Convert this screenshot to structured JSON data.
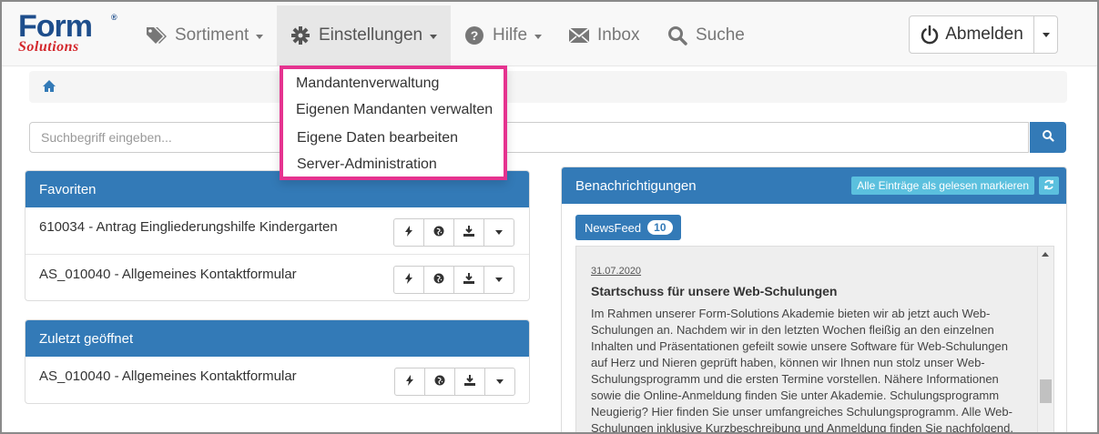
{
  "logo": {
    "word": "Form",
    "sub": "Solutions",
    "reg": "®"
  },
  "nav": {
    "sortiment": "Sortiment",
    "einstellungen": "Einstellungen",
    "hilfe": "Hilfe",
    "inbox": "Inbox",
    "suche": "Suche",
    "logout": "Abmelden"
  },
  "dropdown": {
    "items": [
      "Mandantenverwaltung",
      "Eigenen Mandanten verwalten",
      "Eigene Daten bearbeiten",
      "Server-Administration"
    ],
    "highlight_color": "#e5338f"
  },
  "search": {
    "placeholder": "Suchbegriff eingeben..."
  },
  "favorites": {
    "title": "Favoriten",
    "items": [
      "610034 - Antrag Eingliederungshilfe Kindergarten",
      "AS_010040 - Allgemeines Kontaktformular"
    ]
  },
  "recent": {
    "title": "Zuletzt geöffnet",
    "items": [
      "AS_010040 - Allgemeines Kontaktformular"
    ]
  },
  "notifications": {
    "title": "Benachrichtigungen",
    "mark_all": "Alle Einträge als gelesen markieren",
    "newsfeed": "NewsFeed",
    "newsfeed_count": "10",
    "entry": {
      "date": "31.07.2020",
      "title": "Startschuss für unsere Web-Schulungen",
      "body": "Im Rahmen unserer Form-Solutions Akademie bieten wir ab jetzt auch Web-Schulungen an. Nachdem wir in den letzten Wochen fleißig an den einzelnen Inhalten und Präsentationen gefeilt sowie unsere Software für Web-Schulungen auf Herz und Nieren geprüft haben, können wir Ihnen nun stolz unser Web-Schulungsprogramm und die ersten Termine vorstellen. Nähere Informationen sowie die Online-Anmeldung finden Sie unter Akademie. Schulungsprogramm Neugierig? Hier finden Sie unser umfangreiches Schulungsprogramm. Alle Web-Schulungen inklusive Kurzbeschreibung und Anmeldung finden Sie nachfolgend."
    }
  },
  "colors": {
    "primary": "#337ab7",
    "info": "#5bc0de",
    "brand_blue": "#1e4e8c",
    "brand_red": "#d3262b"
  }
}
